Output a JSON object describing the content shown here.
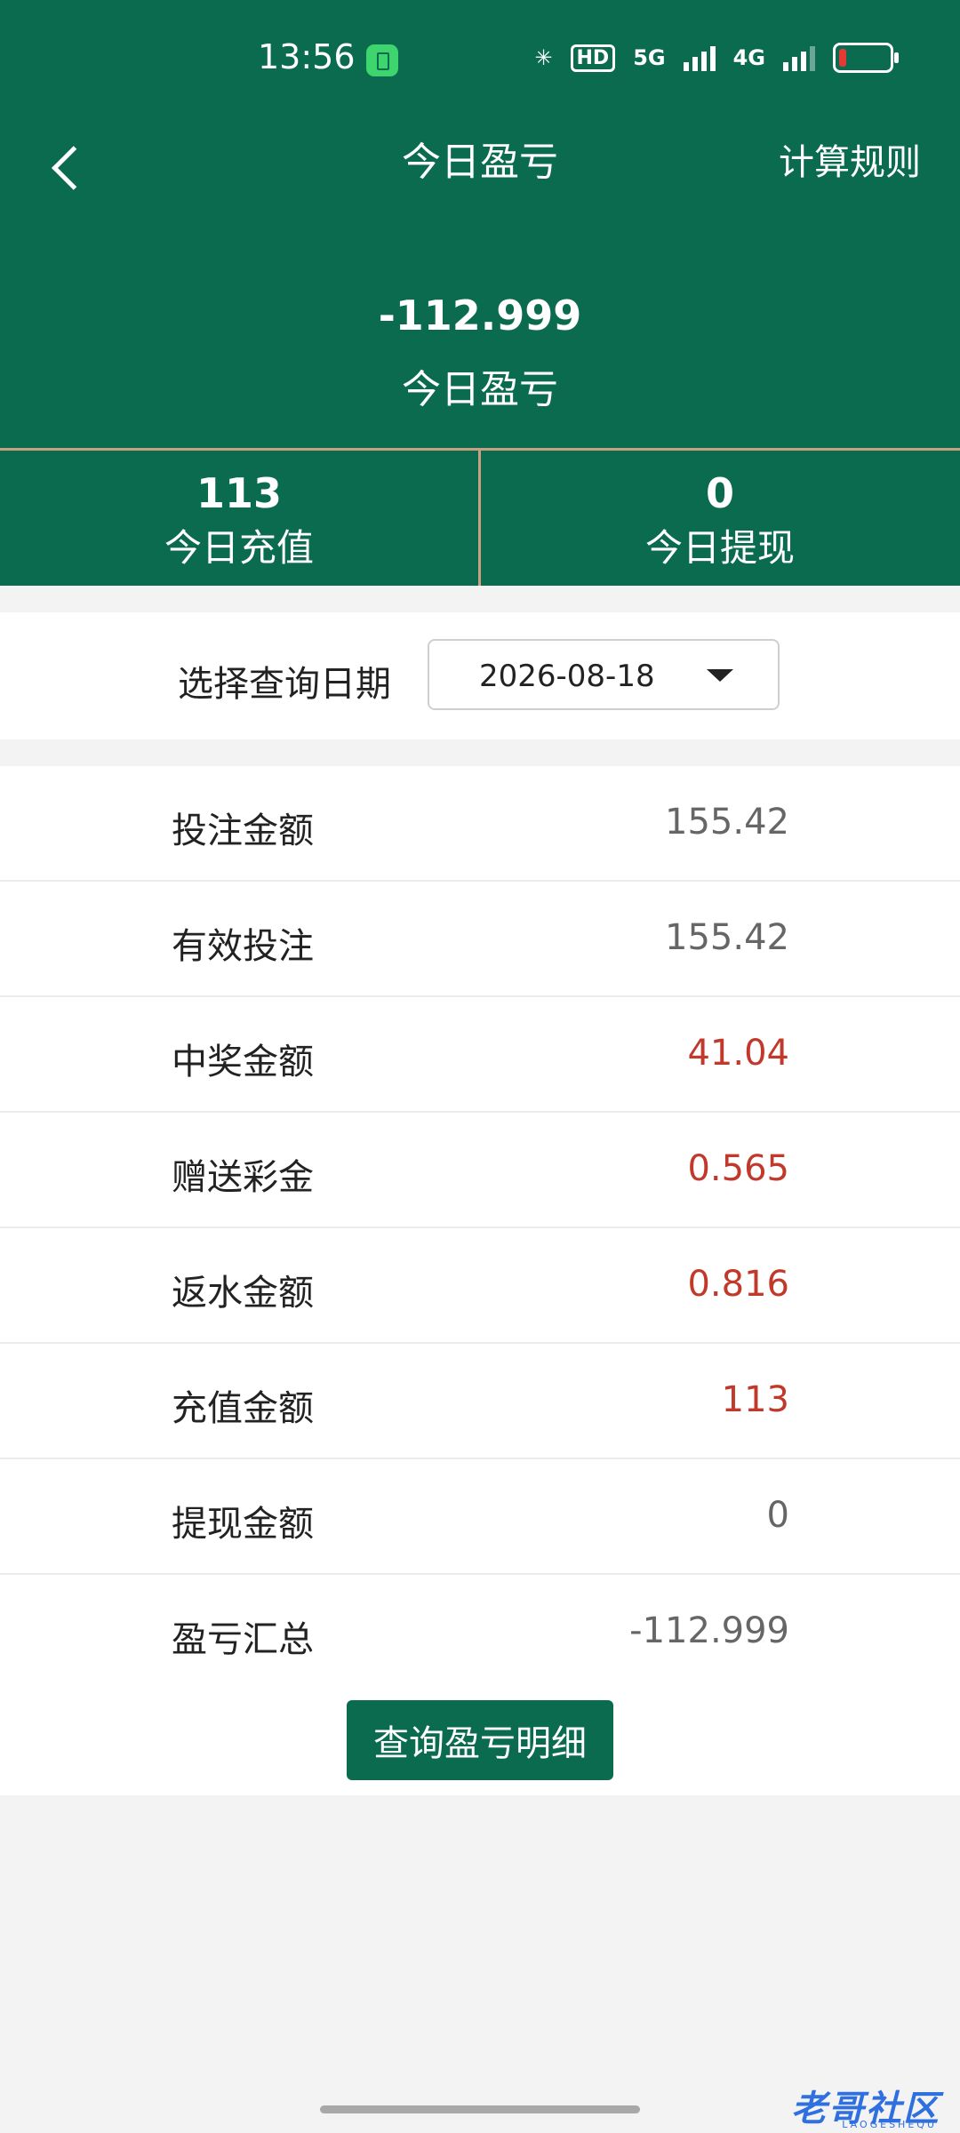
{
  "status_bar": {
    "time": "13:56",
    "network_1": "5G",
    "network_2": "4G",
    "hd_badge": "HD",
    "battery_level": 0.15
  },
  "header": {
    "title": "今日盈亏",
    "rules_link": "计算规则",
    "summary_value": "-112.999",
    "summary_label": "今日盈亏"
  },
  "stats": {
    "recharge_value": "113",
    "recharge_label": "今日充值",
    "withdraw_value": "0",
    "withdraw_label": "今日提现"
  },
  "date_filter": {
    "label": "选择查询日期",
    "value": "2026-08-18"
  },
  "rows": [
    {
      "label": "投注金额",
      "value": "155.42"
    },
    {
      "label": "有效投注",
      "value": "155.42"
    },
    {
      "label": "中奖金额",
      "value": "41.04"
    },
    {
      "label": "赠送彩金",
      "value": "0.565"
    },
    {
      "label": "返水金额",
      "value": "0.816"
    },
    {
      "label": "充值金额",
      "value": "113"
    },
    {
      "label": "提现金额",
      "value": "0"
    },
    {
      "label": "盈亏汇总",
      "value": "-112.999"
    }
  ],
  "query_button": "查询盈亏明细",
  "watermark": {
    "text": "老哥社区",
    "sub": "LAOGESHEQU"
  },
  "colors": {
    "primary": "#0a6b4f",
    "divider": "#c9a083",
    "highlight_value": "#c0392b"
  }
}
